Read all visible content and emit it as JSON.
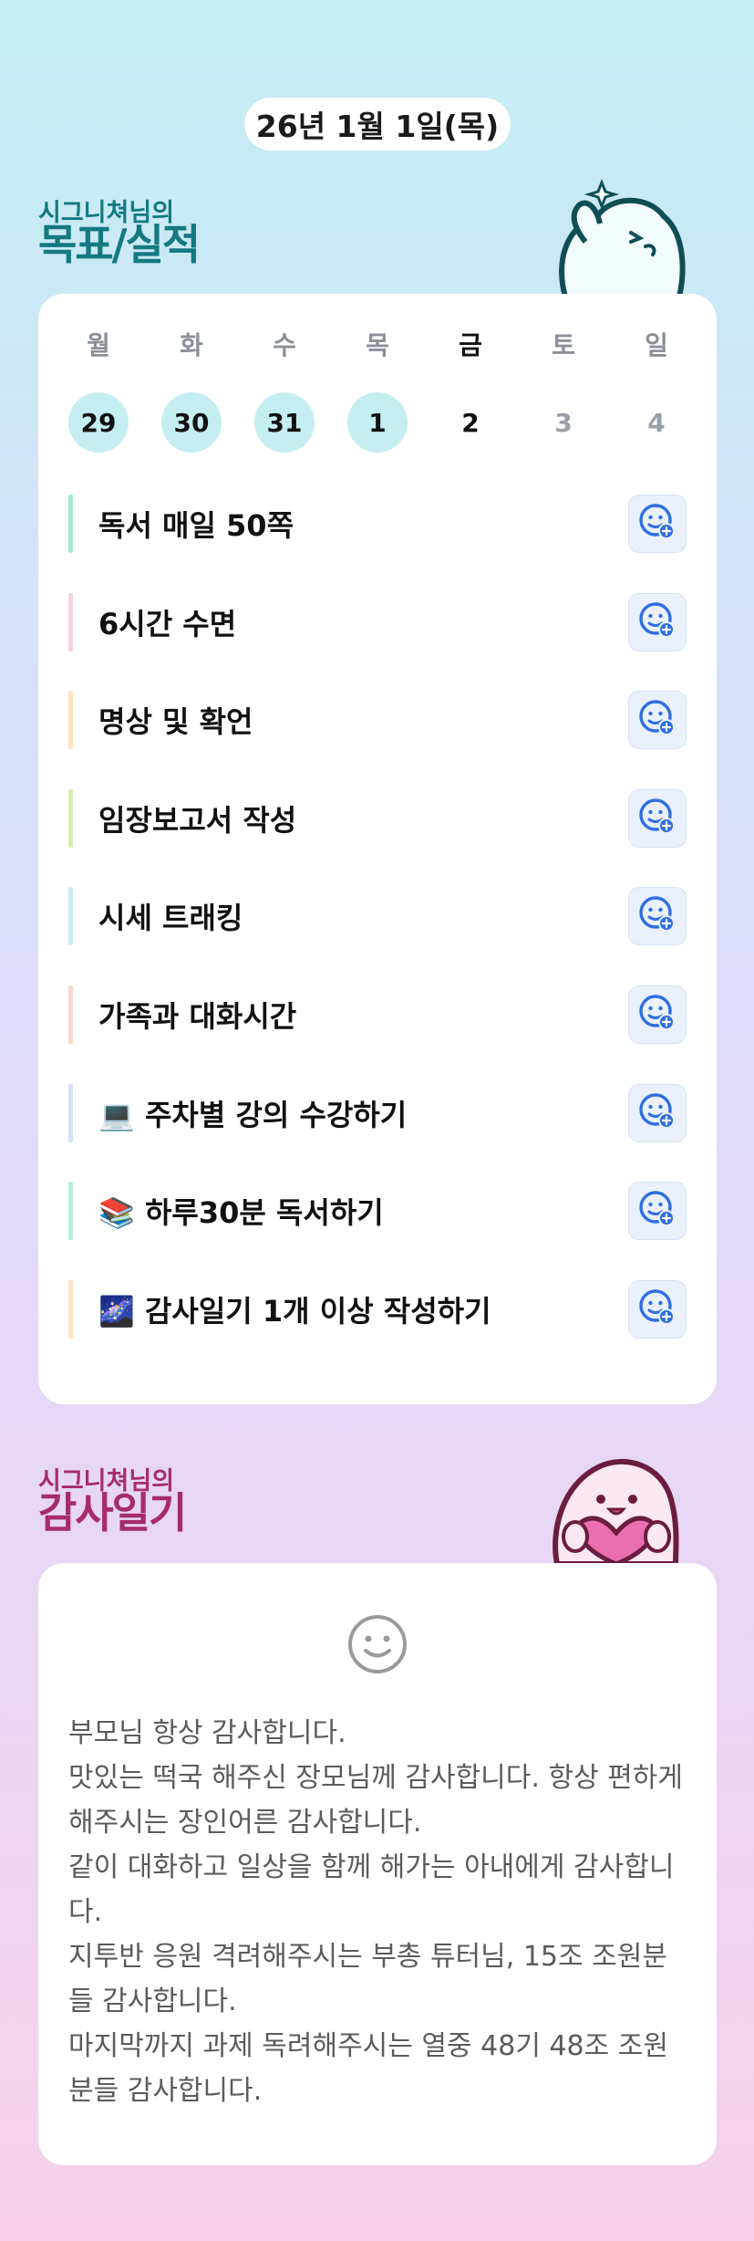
{
  "header": {
    "date": "26년 1월 1일(목)"
  },
  "goals_section": {
    "owner": "시그니쳐님의",
    "title": "목표/실적"
  },
  "week": {
    "days": [
      "월",
      "화",
      "수",
      "목",
      "금",
      "토",
      "일"
    ],
    "dates": [
      "29",
      "30",
      "31",
      "1",
      "2",
      "3",
      "4"
    ],
    "status": [
      "done",
      "done",
      "done",
      "done",
      "today",
      "future",
      "future"
    ]
  },
  "goals": [
    {
      "label": "독서 매일 50쪽",
      "color": "#a6e8d5"
    },
    {
      "label": "6시간 수면",
      "color": "#f8cfe4"
    },
    {
      "label": "명상 및 확언",
      "color": "#fde0bf"
    },
    {
      "label": "임장보고서 작성",
      "color": "#d6f0b4"
    },
    {
      "label": "시세 트래킹",
      "color": "#c8eef5"
    },
    {
      "label": "가족과 대화시간",
      "color": "#fbd6cf"
    },
    {
      "label": "💻 주차별 강의 수강하기",
      "color": "#d8dffb"
    },
    {
      "label": "📚 하루30분 독서하기",
      "color": "#b8eed8"
    },
    {
      "label": "🌌 감사일기 1개 이상 작성하기",
      "color": "#fde4c4"
    }
  ],
  "gratitude_section": {
    "owner": "시그니쳐님의",
    "title": "감사일기"
  },
  "gratitude": {
    "icon": "smiley-face-icon",
    "text": "부모님 항상 감사합니다.\n맛있는 떡국 해주신 장모님께 감사합니다. 항상 편하게 해주시는 장인어른 감사합니다.\n같이 대화하고 일상을 함께 해가는 아내에게 감사합니다.\n지투반 응원 격려해주시는 부총 튜터님, 15조 조원분들 감사합니다.\n마지막까지 과제 독려해주시는 열중 48기 48조 조원분들 감사합니다."
  },
  "colors": {
    "goal_title": "#137a80",
    "gratitude_title": "#a62c6c",
    "done_day": "#c5eef3",
    "accent_blue": "#2f6ee0"
  }
}
